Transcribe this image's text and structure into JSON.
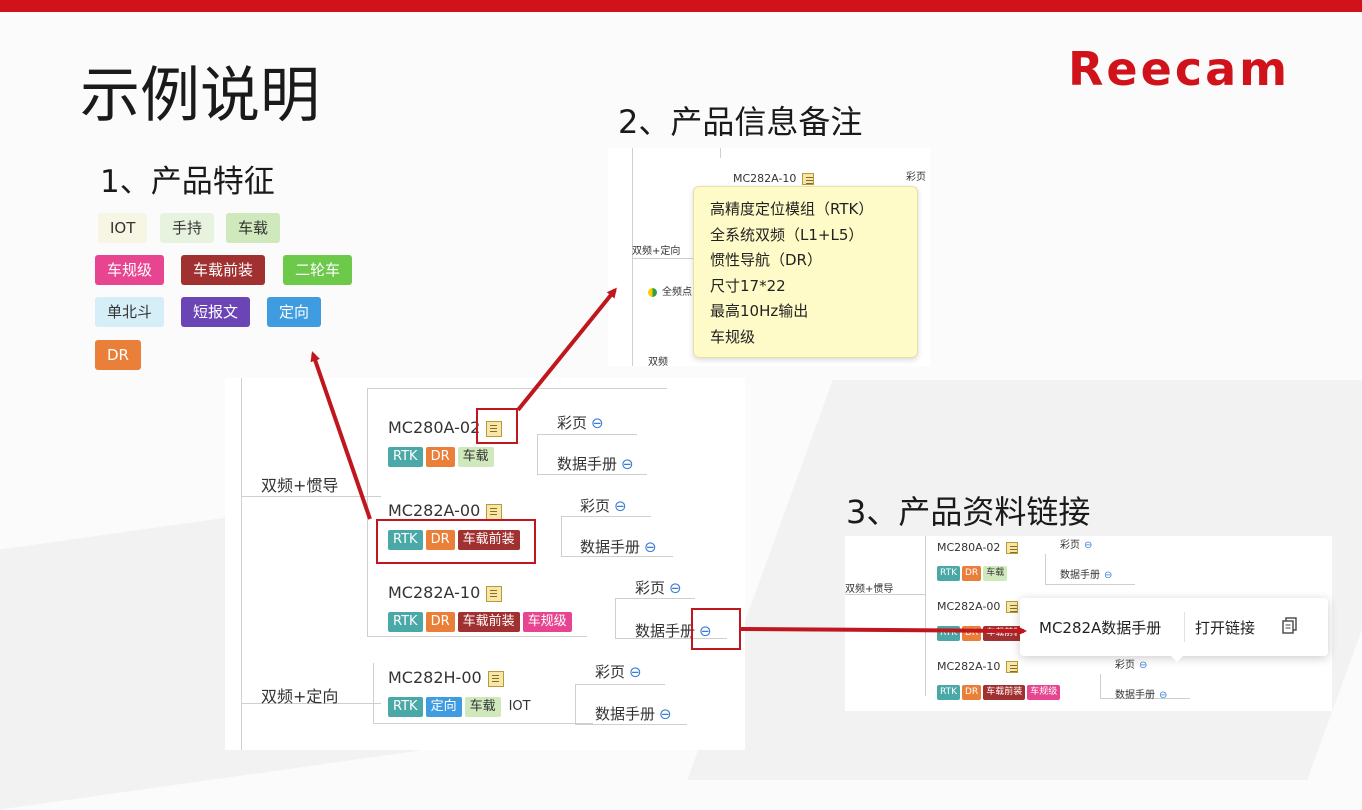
{
  "colors": {
    "brand": "#d0121b",
    "rtk": "#4aa8a7",
    "dr": "#e97f38",
    "vehicle": "#cfe9bd",
    "front": "#a13030",
    "regulation": "#e7458f",
    "twowheel": "#6cc94a",
    "beidou": "#d6eef8",
    "sms": "#6b45b5",
    "orient": "#3f9ce0"
  },
  "title": "示例说明",
  "logo": "Reecam",
  "sections": {
    "features": "1、产品特征",
    "notes": "2、产品信息备注",
    "links": "3、产品资料链接"
  },
  "feature_tags": [
    "IOT",
    "手持",
    "车载",
    "车规级",
    "车载前装",
    "二轮车",
    "单北斗",
    "短报文",
    "定向",
    "DR"
  ],
  "mindmap": {
    "groups": [
      "双频+惯导",
      "双频+定向"
    ],
    "products": [
      {
        "name": "MC280A-02",
        "tags": [
          "RTK",
          "DR",
          "车载"
        ],
        "links": [
          "彩页",
          "数据手册"
        ]
      },
      {
        "name": "MC282A-00",
        "tags": [
          "RTK",
          "DR",
          "车载前装"
        ],
        "links": [
          "彩页",
          "数据手册"
        ]
      },
      {
        "name": "MC282A-10",
        "tags": [
          "RTK",
          "DR",
          "车载前装",
          "车规级"
        ],
        "links": [
          "彩页",
          "数据手册"
        ]
      },
      {
        "name": "MC282H-00",
        "tags": [
          "RTK",
          "定向",
          "车载",
          "IOT"
        ],
        "links": [
          "彩页",
          "数据手册"
        ]
      }
    ]
  },
  "note_panel": {
    "node": "MC282A-10",
    "side_text": "彩页",
    "group": "双频+定向",
    "row": "全频点",
    "bottom": "双频",
    "tooltip_lines": [
      "高精度定位模组（RTK）",
      "全系统双频（L1+L5）",
      "惯性导航（DR）",
      "尺寸17*22",
      "最高10Hz输出",
      "车规级"
    ]
  },
  "link_panel": {
    "group": "双频+惯导",
    "popup_title": "MC282A数据手册",
    "popup_action": "打开链接"
  },
  "icons": {
    "note": "note-icon",
    "link": "link-icon",
    "copy": "copy-icon",
    "status": "status-dot-icon"
  }
}
